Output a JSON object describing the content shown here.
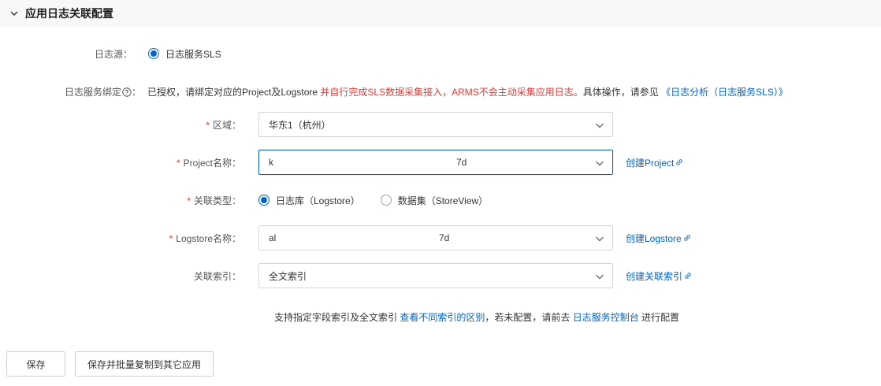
{
  "section": {
    "title": "应用日志关联配置"
  },
  "log_source": {
    "label": "日志源：",
    "option": "日志服务SLS"
  },
  "binding": {
    "label": "日志服务绑定",
    "colon": "：",
    "text_prefix": "已授权，请绑定对应的Project及Logstore",
    "text_warning": " 并自行完成SLS数据采集接入，ARMS不会主动采集应用日志。",
    "text_suffix": "具体操作，请参见",
    "doc_link": "《日志分析（日志服务SLS）》"
  },
  "region": {
    "required": "*",
    "label": "区域：",
    "value": "华东1（杭州）"
  },
  "project": {
    "required": "*",
    "label": "Project名称：",
    "value_a": "k",
    "value_b": "7d",
    "create_link": "创建Project"
  },
  "assoc_type": {
    "required": "*",
    "label": "关联类型：",
    "options": [
      "日志库（Logstore）",
      "数据集（StoreView）"
    ],
    "selected": 0
  },
  "logstore": {
    "required": "*",
    "label": "Logstore名称：",
    "value_a": "al",
    "value_b": "7d",
    "create_link": "创建Logstore"
  },
  "index": {
    "label": "关联索引：",
    "value": "全文索引",
    "create_link": "创建关联索引"
  },
  "hint": {
    "prefix": "支持指定字段索引及全文索引 ",
    "link1": "查看不同索引的区别",
    "middle": "，若未配置，请前去 ",
    "link2": "日志服务控制台",
    "suffix": " 进行配置"
  },
  "buttons": {
    "save": "保存",
    "save_copy": "保存并批量复制到其它应用"
  },
  "colors": {
    "primary": "#0064c8",
    "danger": "#e53935",
    "border": "#d1d5db",
    "header_bg": "#f7f8fa"
  }
}
